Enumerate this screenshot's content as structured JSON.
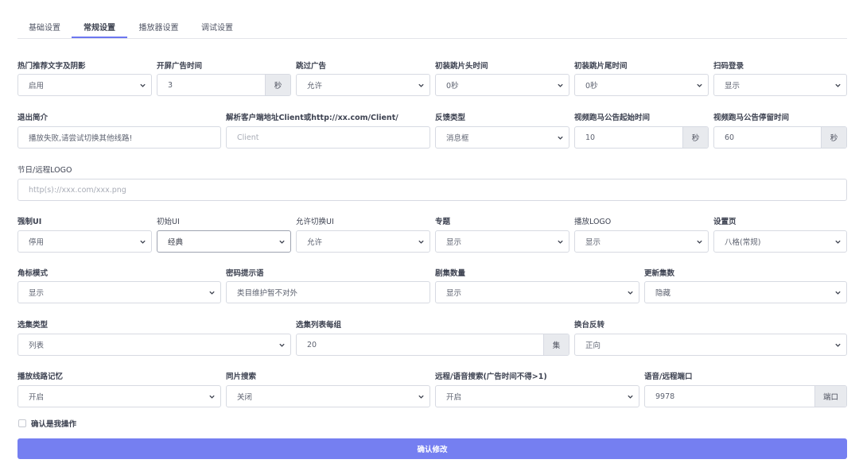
{
  "tabs": [
    {
      "label": "基础设置"
    },
    {
      "label": "常规设置"
    },
    {
      "label": "播放器设置"
    },
    {
      "label": "调试设置"
    }
  ],
  "fields": {
    "hot_text": {
      "label": "热门推荐文字及阴影",
      "value": "启用"
    },
    "splash_time": {
      "label": "开屏广告时间",
      "value": "3",
      "unit": "秒"
    },
    "skip_ad": {
      "label": "跳过广告",
      "value": "允许"
    },
    "skip_head": {
      "label": "初装跳片头时间",
      "value": "0秒"
    },
    "skip_tail": {
      "label": "初装跳片尾时间",
      "value": "0秒"
    },
    "qr_login": {
      "label": "扫码登录",
      "value": "显示"
    },
    "exit_intro": {
      "label": "退出简介",
      "value": "播放失败,请尝试切换其他线路!"
    },
    "client_url": {
      "label": "解析客户端地址Client或http://xx.com/Client/",
      "placeholder": "Client"
    },
    "feedback_type": {
      "label": "反馈类型",
      "value": "消息框"
    },
    "marquee_start": {
      "label": "视频跑马公告起始时间",
      "value": "10",
      "unit": "秒"
    },
    "marquee_stay": {
      "label": "视频跑马公告停留时间",
      "value": "60",
      "unit": "秒"
    },
    "holiday_logo": {
      "label": "节日/远程LOGO",
      "placeholder": "http(s)://xxx.com/xxx.png"
    },
    "force_ui": {
      "label": "强制UI",
      "value": "停用"
    },
    "init_ui": {
      "label": "初始UI",
      "value": "经典"
    },
    "allow_switch_ui": {
      "label": "允许切换UI",
      "value": "允许"
    },
    "topic": {
      "label": "专题",
      "value": "显示"
    },
    "play_logo": {
      "label": "播放LOGO",
      "value": "显示"
    },
    "settings_page": {
      "label": "设置页",
      "value": "八格(常规)"
    },
    "badge_mode": {
      "label": "角标模式",
      "value": "显示"
    },
    "pwd_hint": {
      "label": "密码提示语",
      "value": "类目维护暂不对外"
    },
    "episode_count": {
      "label": "剧集数量",
      "value": "显示"
    },
    "update_count": {
      "label": "更新集数",
      "value": "隐藏"
    },
    "ep_select_type": {
      "label": "选集类型",
      "value": "列表"
    },
    "ep_per_group": {
      "label": "选集列表每组",
      "value": "20",
      "unit": "集"
    },
    "channel_reverse": {
      "label": "换台反转",
      "value": "正向"
    },
    "line_memory": {
      "label": "播放线路记忆",
      "value": "开启"
    },
    "same_search": {
      "label": "同片搜索",
      "value": "关闭"
    },
    "voice_search": {
      "label": "远程/语音搜索(广告时间不得>1)",
      "value": "开启"
    },
    "voice_port": {
      "label": "语音/远程端口",
      "value": "9978",
      "unit": "端口"
    }
  },
  "confirm_label": "确认是我操作",
  "submit_label": "确认修改"
}
